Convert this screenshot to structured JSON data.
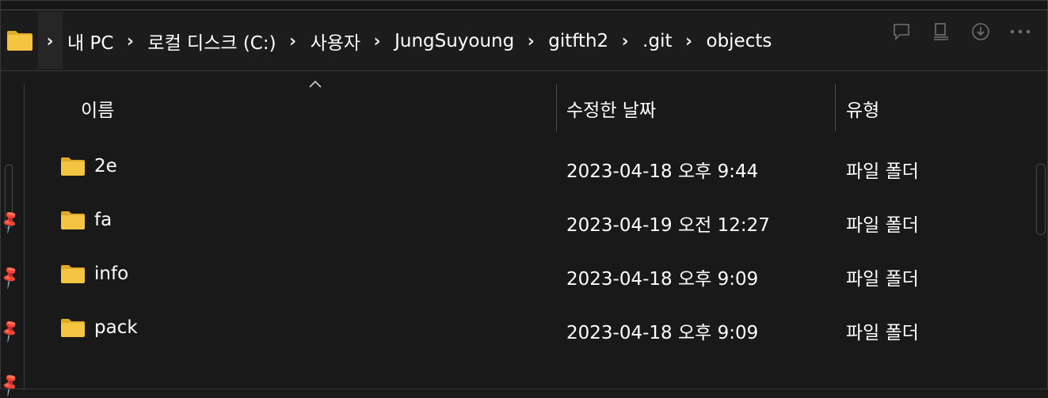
{
  "address": {
    "folder_icon": "folder-icon",
    "crumbs": [
      "내 PC",
      "로컬 디스크 (C:)",
      "사용자",
      "JungSuyoung",
      "gitfth2",
      ".git",
      "objects"
    ],
    "separator": "›"
  },
  "toolbar": {
    "icons": [
      "comment-icon",
      "details-pane-icon",
      "download-icon",
      "more-icon"
    ]
  },
  "columns": {
    "name": "이름",
    "date": "수정한 날짜",
    "type": "유형"
  },
  "files": [
    {
      "name": "2e",
      "date": "2023-04-18 오후 9:44",
      "type": "파일 폴더"
    },
    {
      "name": "fa",
      "date": "2023-04-19 오전 12:27",
      "type": "파일 폴더"
    },
    {
      "name": "info",
      "date": "2023-04-18 오후 9:09",
      "type": "파일 폴더"
    },
    {
      "name": "pack",
      "date": "2023-04-18 오후 9:09",
      "type": "파일 폴더"
    }
  ],
  "colors": {
    "background": "#191919",
    "folder": "#f5c542",
    "folder_tab": "#e0a92a"
  }
}
